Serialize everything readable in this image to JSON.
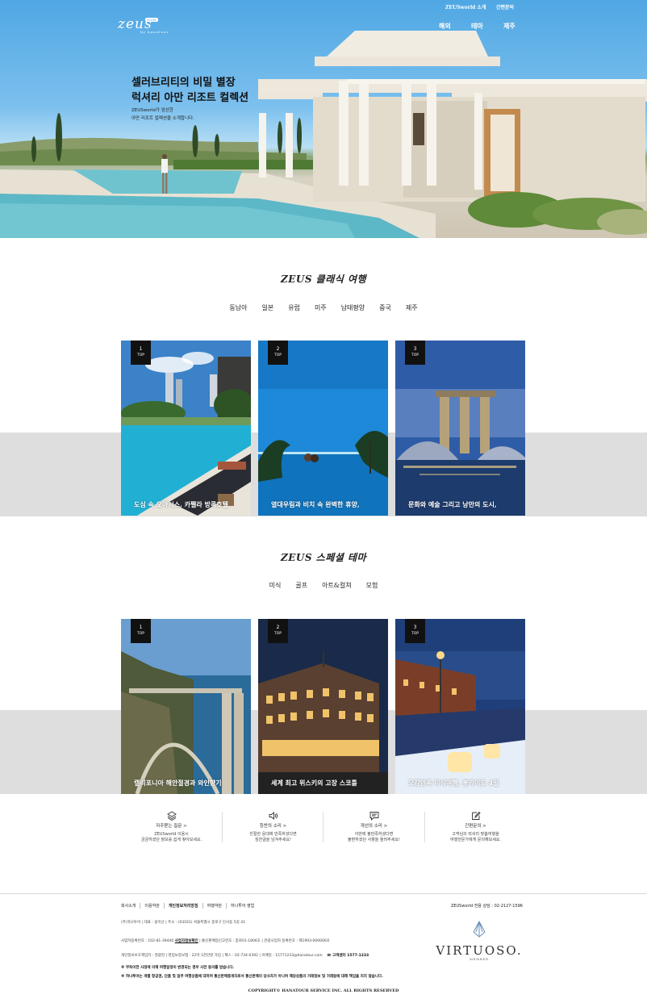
{
  "header": {
    "logo_text": "zeus",
    "logo_sub": "by hanatour",
    "logo_badge": "world",
    "utility_links": [
      "ZEUSworld 소개",
      "간편문의"
    ],
    "nav": [
      "해외",
      "테마",
      "제주"
    ]
  },
  "hero": {
    "title_line1": "셀러브리티의 비밀 별장",
    "title_line2": "럭셔리 아만 리조트 컬렉션",
    "desc_line1": "ZEUSworld가 엄선한",
    "desc_line2": "아만 리조트 컬렉션을 소개합니다."
  },
  "classic": {
    "title": "ZEUS 클래식 여행",
    "tabs": [
      "동남아",
      "일본",
      "유럽",
      "미주",
      "남태평양",
      "중국",
      "제주"
    ],
    "cards": [
      {
        "rank": "1",
        "rank_label": "TOP",
        "caption": "도심 속 오아시스, 카펠라 방콕호텔"
      },
      {
        "rank": "2",
        "rank_label": "TOP",
        "caption": "열대우림과 비치 속 완벽한 휴양,"
      },
      {
        "rank": "3",
        "rank_label": "TOP",
        "caption": "문화와 예술 그리고 낭만의 도시,"
      }
    ]
  },
  "special": {
    "title": "ZEUS 스페셜 테마",
    "tabs": [
      "미식",
      "골프",
      "아트&컬쳐",
      "모험"
    ],
    "cards": [
      {
        "rank": "1",
        "rank_label": "TOP",
        "caption": "캘리포니아 해안절경과 와인향기"
      },
      {
        "rank": "2",
        "rank_label": "TOP",
        "caption": "세계 최고 위스키의 고장 스코틀"
      },
      {
        "rank": "3",
        "rank_label": "TOP",
        "caption": "오감만족 미식여행, 홋카이도 4일"
      }
    ]
  },
  "services": [
    {
      "icon": "layers-icon",
      "title": "자주묻는 질문 >",
      "desc1": "ZEUSworld 이용시",
      "desc2": "궁금하셨던 정보를 쉽게 찾아보세요."
    },
    {
      "icon": "speaker-icon",
      "title": "칭찬의 소리 >",
      "desc1": "친절한 응대에 만족하셨다면",
      "desc2": "칭찬글을 남겨주세요!"
    },
    {
      "icon": "message-icon",
      "title": "개선의 소리 >",
      "desc1": "이번에 불만족하셨다면",
      "desc2": "불편하셨던 사항을 들려주세요!"
    },
    {
      "icon": "edit-icon",
      "title": "간편문의 >",
      "desc1": "고객님의 럭셔리 맞춤여행을",
      "desc2": "여행전문가에게 문의해보세요."
    }
  ],
  "footer": {
    "links": [
      "회사소개",
      "이용약관",
      "개인정보처리방침",
      "여행약관",
      "하나투어 영업"
    ],
    "call": "ZEUSworld 전용 상담 : 02-2127-1596",
    "company": "(주)하나투어 | 대표 : 송미선 | 주소 : (03161) 서울특별시 종로구 인사동 5길 41",
    "biz_no": "사업자등록번호 : 102-81-39440",
    "biz_link": "사업자정보확인",
    "biz_rest": "| 통신판매업신고번호 : 종로01-1806호 | 관광사업자 등록번호 : 제1993-000006호",
    "privacy": "개인정보보호책임자 : 권광현 | 영업보증보험 : 22억 1천만원 가입 | 팩스 : 02-734-0392 | 이메일 : 15771233@hanatour.com",
    "hotline": "고객센터 1577-1233",
    "notice1": "※ 부득이한 사정에 의해 여행일정이 변경되는 경우 사전 동의를 받습니다.",
    "notice2": "※ 하나투어는 개별 항공권, 단품 및 일부 여행상품에 대하여 통신판매중개자로서 통신판매의 당사자가 아니며 해당상품의 거래정보 및 거래등에 대해 책임을 지지 않습니다.",
    "partner_name": "VIRTUOSO.",
    "partner_sub": "MEMBER",
    "copyright": "COPYRIGHT© HANATOUR SERVICE INC. ALL RIGHTS RESERVED"
  }
}
